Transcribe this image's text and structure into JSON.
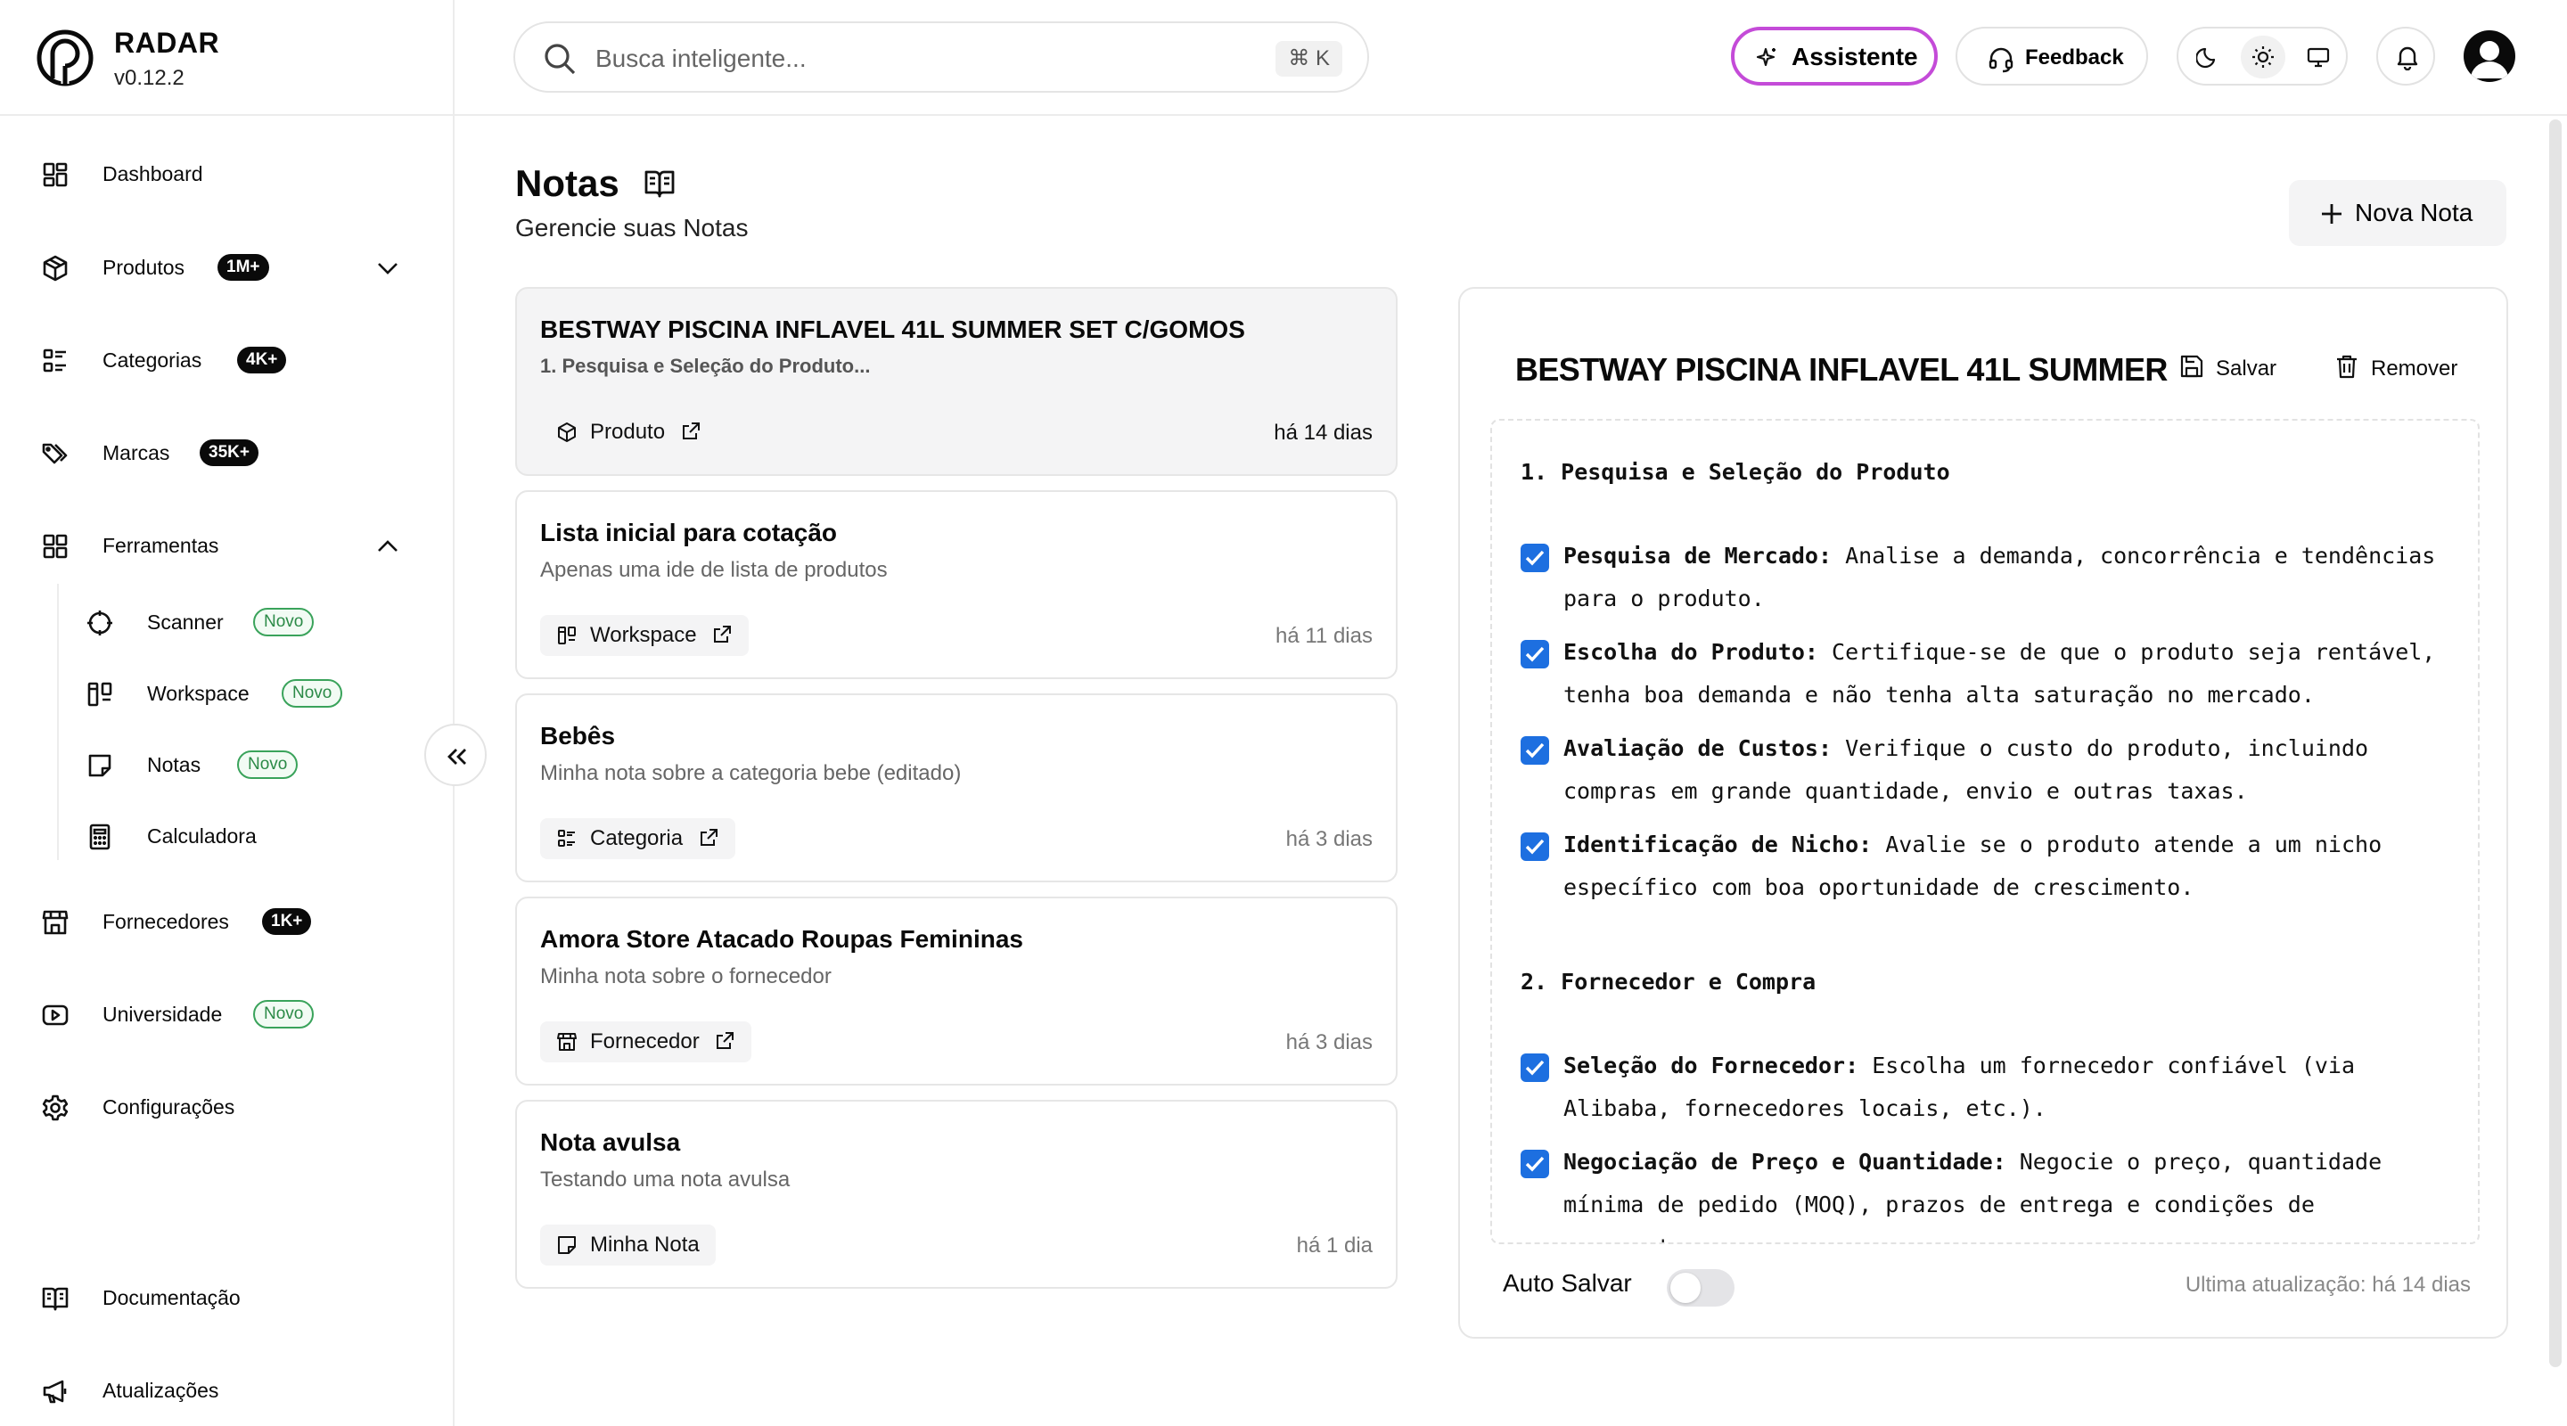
{
  "brand": {
    "name": "RADAR",
    "version": "v0.12.2"
  },
  "sidebar": {
    "items": [
      {
        "label": "Dashboard"
      },
      {
        "label": "Produtos",
        "badge": "1M+"
      },
      {
        "label": "Categorias",
        "badge": "4K+"
      },
      {
        "label": "Marcas",
        "badge": "35K+"
      },
      {
        "label": "Ferramentas"
      },
      {
        "label": "Fornecedores",
        "badge": "1K+"
      },
      {
        "label": "Universidade",
        "badge": "Novo"
      },
      {
        "label": "Configurações"
      }
    ],
    "tools": [
      {
        "label": "Scanner",
        "badge": "Novo"
      },
      {
        "label": "Workspace",
        "badge": "Novo"
      },
      {
        "label": "Notas",
        "badge": "Novo"
      },
      {
        "label": "Calculadora"
      }
    ],
    "footer": [
      {
        "label": "Documentação"
      },
      {
        "label": "Atualizações"
      }
    ]
  },
  "topbar": {
    "search_placeholder": "Busca inteligente...",
    "shortcut": "⌘ K",
    "assistant_label": "Assistente",
    "feedback_label": "Feedback"
  },
  "page": {
    "title": "Notas",
    "subtitle": "Gerencie suas Notas",
    "new_note_label": "Nova Nota"
  },
  "notes": [
    {
      "title": "BESTWAY PISCINA INFLAVEL 41L SUMMER SET C/GOMOS",
      "desc": "1. Pesquisa e Seleção do Produto...",
      "tag": "Produto",
      "date": "há 14 dias"
    },
    {
      "title": "Lista inicial para cotação",
      "desc": "Apenas uma ide de lista de produtos",
      "tag": "Workspace",
      "date": "há 11 dias"
    },
    {
      "title": "Bebês",
      "desc": "Minha nota sobre a categoria bebe (editado)",
      "tag": "Categoria",
      "date": "há 3 dias"
    },
    {
      "title": "Amora Store Atacado Roupas Femininas",
      "desc": "Minha nota sobre o fornecedor",
      "tag": "Fornecedor",
      "date": "há 3 dias"
    },
    {
      "title": "Nota avulsa",
      "desc": "Testando uma nota avulsa",
      "tag": "Minha Nota",
      "date": "há 1 dia"
    }
  ],
  "editor": {
    "title": "BESTWAY PISCINA INFLAVEL 41L SUMMER",
    "save_label": "Salvar",
    "remove_label": "Remover",
    "sections": [
      {
        "heading": "1. Pesquisa e Seleção do Produto",
        "items": [
          {
            "bold": "Pesquisa de Mercado:",
            "text": " Analise a demanda, concorrência e tendências para o produto.",
            "checked": true
          },
          {
            "bold": "Escolha do Produto:",
            "text": " Certifique-se de que o produto seja rentável, tenha boa demanda e não tenha alta saturação no mercado.",
            "checked": true
          },
          {
            "bold": "Avaliação de Custos:",
            "text": " Verifique o custo do produto, incluindo compras em grande quantidade, envio e outras taxas.",
            "checked": true
          },
          {
            "bold": "Identificação de Nicho:",
            "text": " Avalie se o produto atende a um nicho específico com boa oportunidade de crescimento.",
            "checked": true
          }
        ]
      },
      {
        "heading": "2. Fornecedor e Compra",
        "items": [
          {
            "bold": "Seleção do Fornecedor:",
            "text": " Escolha um fornecedor confiável (via Alibaba, fornecedores locais, etc.).",
            "checked": true
          },
          {
            "bold": "Negociação de Preço e Quantidade:",
            "text": " Negocie o preço, quantidade mínima de pedido (MOQ), prazos de entrega e condições de pagamento.",
            "checked": true
          }
        ]
      }
    ],
    "autosave_label": "Auto Salvar",
    "autosave_on": false,
    "last_update": "Ultima atualização: há 14 dias"
  },
  "colors": {
    "accent_checkbox": "#1d6fe0",
    "assistant_border": "#c44bd8",
    "novo_badge": "#2b8a47"
  }
}
